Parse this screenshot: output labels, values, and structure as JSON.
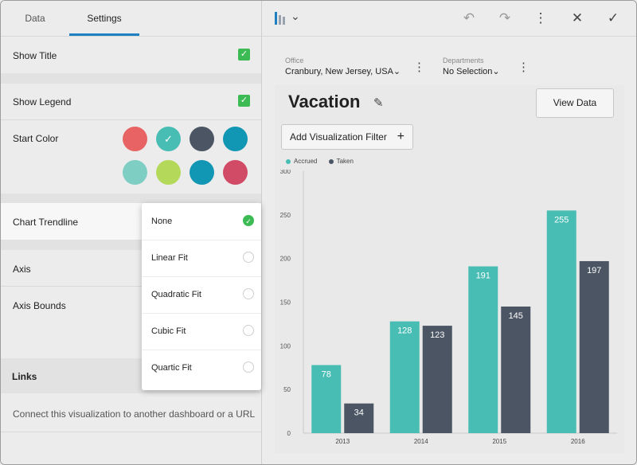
{
  "tabs": {
    "data": "Data",
    "settings": "Settings"
  },
  "settings": {
    "show_title": "Show Title",
    "show_legend": "Show Legend",
    "start_color": "Start Color",
    "chart_trendline": "Chart Trendline",
    "axis": "Axis",
    "axis_bounds": "Axis Bounds",
    "links_header": "Links",
    "links_desc": "Connect this visualization to another dashboard or a URL",
    "check_glyph": "✓"
  },
  "swatches": {
    "colors": [
      "#e86363",
      "#48bdb4",
      "#4b5563",
      "#1196b3",
      "#7fcec4",
      "#b4d95a",
      "#1196b3",
      "#d14a66"
    ],
    "selected_glyph": "✓"
  },
  "trendline_options": {
    "items": [
      "None",
      "Linear Fit",
      "Quadratic Fit",
      "Cubic Fit",
      "Quartic Fit"
    ],
    "selected_glyph": "✓"
  },
  "toolbar": {
    "chart_type_icon": "bar-chart-icon",
    "chevron": "⌄",
    "undo": "↶",
    "redo": "↷",
    "more": "⋮",
    "close": "✕",
    "confirm": "✓"
  },
  "filters": {
    "office_key": "Office",
    "office_value": "Cranbury, New Jersey, USA",
    "departments_key": "Departments",
    "departments_value": "No Selection",
    "caret": "⌄",
    "kebab": "⋮"
  },
  "card": {
    "title": "Vacation",
    "view_data": "View Data",
    "add_filter": "Add Visualization Filter",
    "plus": "+",
    "pencil": "✎"
  },
  "chart_data": {
    "type": "bar",
    "categories": [
      "2013",
      "2014",
      "2015",
      "2016"
    ],
    "series": [
      {
        "name": "Accrued",
        "color": "#48bdb4",
        "values": [
          78,
          128,
          191,
          255
        ]
      },
      {
        "name": "Taken",
        "color": "#4b5563",
        "values": [
          34,
          123,
          145,
          197
        ]
      }
    ],
    "ylim": [
      0,
      300
    ],
    "yticks": [
      0,
      50,
      100,
      150,
      200,
      250,
      300
    ],
    "legend": "top-left",
    "grid": false
  }
}
